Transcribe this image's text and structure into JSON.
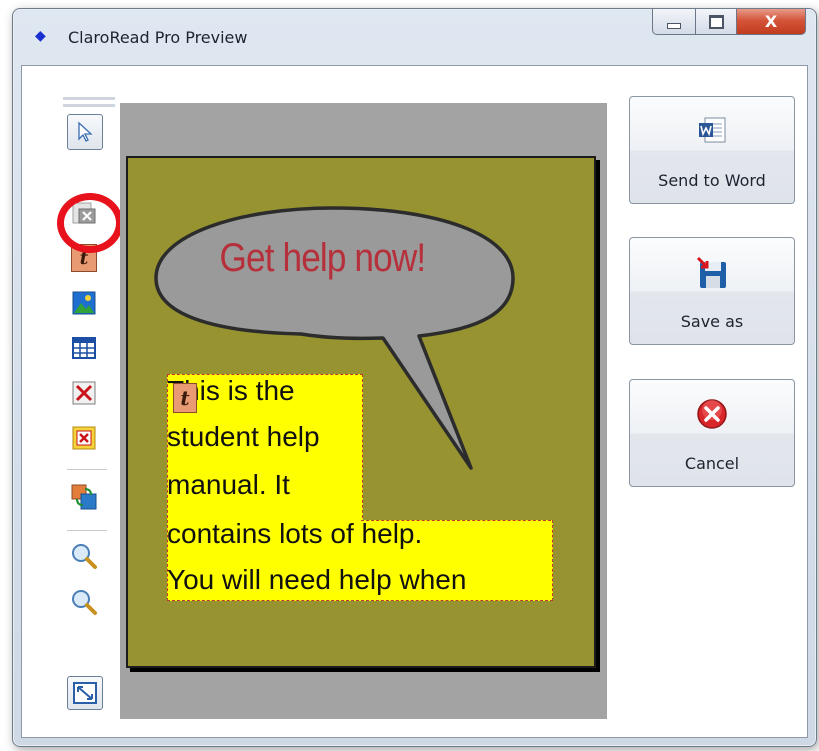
{
  "window": {
    "title": "ClaroRead Pro Preview",
    "close_glyph": "X",
    "title_icon": "diamond-icon"
  },
  "toolbar": {
    "tools": [
      {
        "name": "select-pointer-icon"
      },
      {
        "name": "delete-page-icon"
      },
      {
        "name": "text-box-icon"
      },
      {
        "name": "insert-picture-icon"
      },
      {
        "name": "insert-table-icon"
      },
      {
        "name": "delete-icon"
      },
      {
        "name": "delete-selection-icon"
      },
      {
        "name": "replace-image-icon"
      },
      {
        "name": "zoom-in-icon"
      },
      {
        "name": "zoom-out-icon"
      },
      {
        "name": "fit-page-icon"
      }
    ],
    "text_icon_glyph": "t"
  },
  "page": {
    "bubble_text": "Get help now!",
    "textbox_icon_glyph": "t",
    "lines": [
      "This is the",
      "student help",
      "manual. It",
      "contains lots of help.",
      "You will need help when"
    ]
  },
  "actions": {
    "send_to_word": "Send to Word",
    "save_as": "Save as",
    "cancel": "Cancel"
  },
  "colors": {
    "page_background": "#979330",
    "textbox": "#ffff00",
    "bubble_fill": "#9a9a9a",
    "bubble_text": "#b5303a",
    "highlight_ring": "#e8121c"
  }
}
